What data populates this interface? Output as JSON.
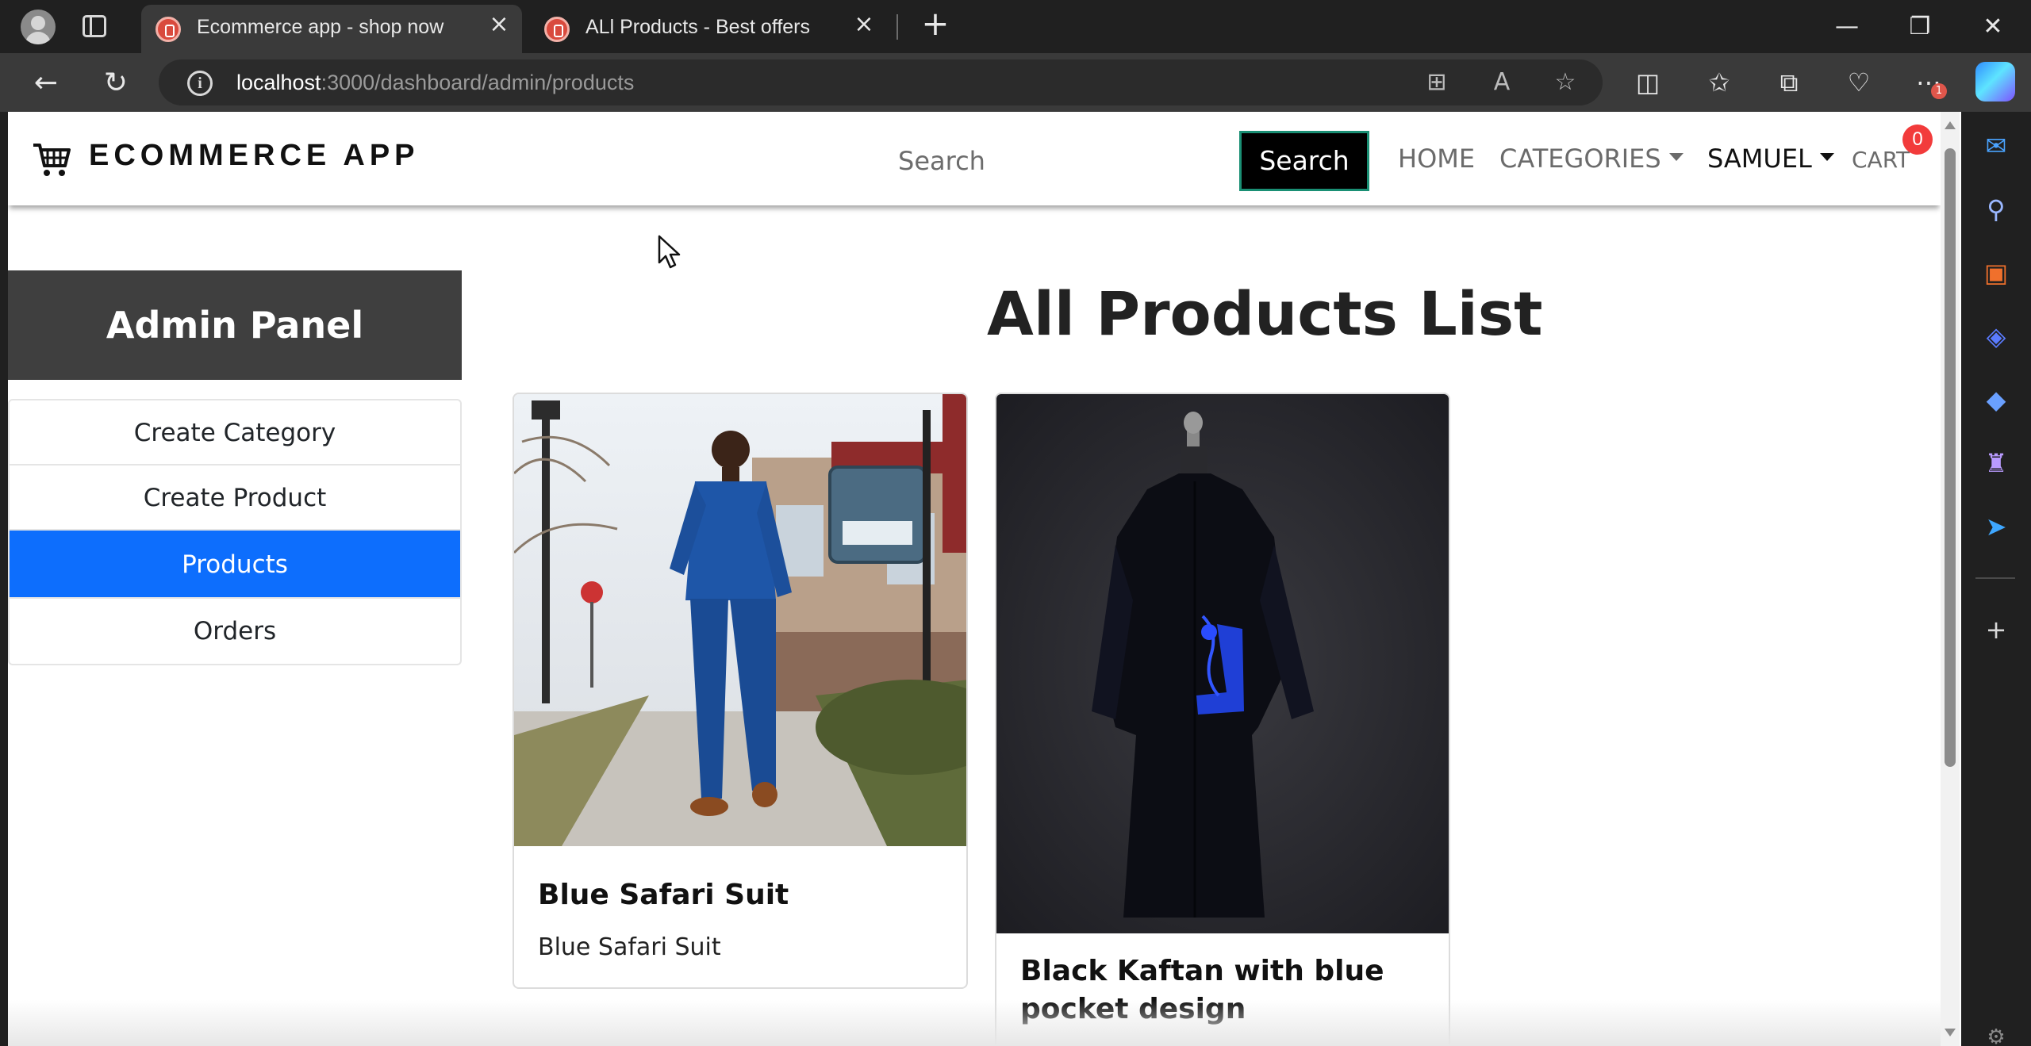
{
  "browser": {
    "tabs": [
      {
        "title": "Ecommerce app - shop now",
        "active": true
      },
      {
        "title": "ALl Products - Best offers",
        "active": false
      }
    ],
    "url_host": "localhost",
    "url_path": ":3000/dashboard/admin/products",
    "notification_count": "1"
  },
  "site": {
    "brand": "ECOMMERCE APP",
    "search_placeholder": "Search",
    "search_button": "Search",
    "nav": {
      "home": "HOME",
      "categories": "CATEGORIES",
      "user": "SAMUEL",
      "cart": "CART",
      "cart_count": "0"
    }
  },
  "admin": {
    "heading": "Admin Panel",
    "menu": [
      {
        "label": "Create Category",
        "active": false
      },
      {
        "label": "Create Product",
        "active": false
      },
      {
        "label": "Products",
        "active": true
      },
      {
        "label": "Orders",
        "active": false
      }
    ]
  },
  "main": {
    "title": "All Products List",
    "products": [
      {
        "name": "Blue Safari Suit",
        "description": "Blue Safari Suit"
      },
      {
        "name": "Black Kaftan with blue pocket design",
        "description": ""
      }
    ]
  },
  "colors": {
    "active_menu": "#0d6efd",
    "admin_header": "#3f3f3f",
    "cart_badge": "#f23b3b"
  }
}
